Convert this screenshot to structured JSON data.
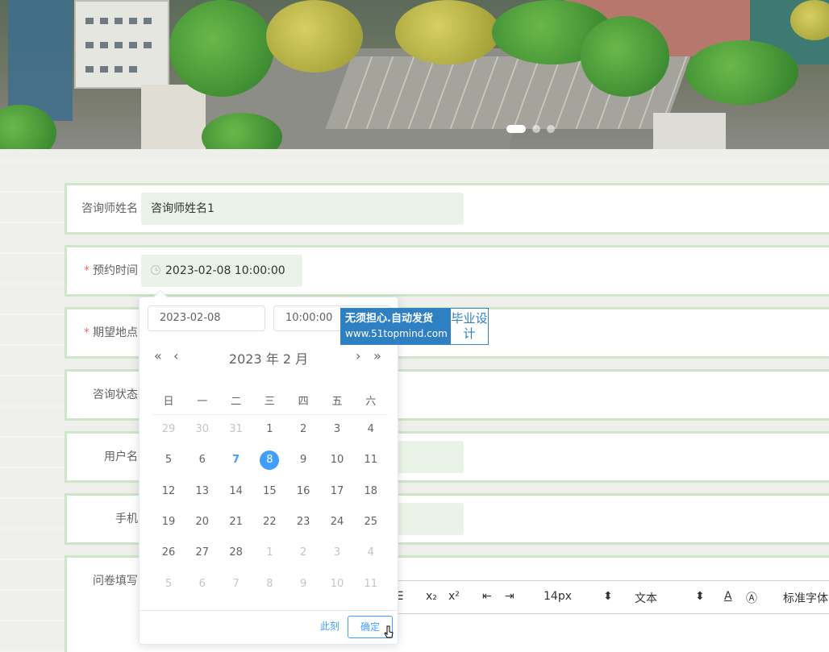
{
  "banner": {
    "dots": 3,
    "active_dot": 0
  },
  "form": {
    "counselor_name": {
      "label": "咨询师姓名",
      "value": "咨询师姓名1"
    },
    "appointment_time": {
      "label": "预约时间",
      "required_mark": "*",
      "value": "2023-02-08 10:00:00"
    },
    "location": {
      "label": "期望地点",
      "required_mark": "*"
    },
    "status": {
      "label": "咨询状态"
    },
    "username": {
      "label": "用户名"
    },
    "phone": {
      "label": "手机"
    },
    "questionnaire": {
      "label": "问卷填写"
    }
  },
  "editor_toolbar": {
    "font_size": "14px",
    "block_type": "文本",
    "font_family": "标准字体"
  },
  "date_picker": {
    "date_input": "2023-02-08",
    "time_input": "10:00:00",
    "year_label": "2023 年",
    "month_label": "2 月",
    "nav": {
      "prev_year": "«",
      "prev_month": "‹",
      "next_month": "›",
      "next_year": "»"
    },
    "weekdays": [
      "日",
      "一",
      "二",
      "三",
      "四",
      "五",
      "六"
    ],
    "weeks": [
      [
        "29",
        "30",
        "31",
        "1",
        "2",
        "3",
        "4"
      ],
      [
        "5",
        "6",
        "7",
        "8",
        "9",
        "10",
        "11"
      ],
      [
        "12",
        "13",
        "14",
        "15",
        "16",
        "17",
        "18"
      ],
      [
        "19",
        "20",
        "21",
        "22",
        "23",
        "24",
        "25"
      ],
      [
        "26",
        "27",
        "28",
        "1",
        "2",
        "3",
        "4"
      ],
      [
        "5",
        "6",
        "7",
        "8",
        "9",
        "10",
        "11"
      ]
    ],
    "now_button": "此刻",
    "confirm_button": "确定"
  },
  "watermark": {
    "line1": "无须担心.自动发货",
    "line2": "www.51topmind.com",
    "side": "毕业设计"
  }
}
